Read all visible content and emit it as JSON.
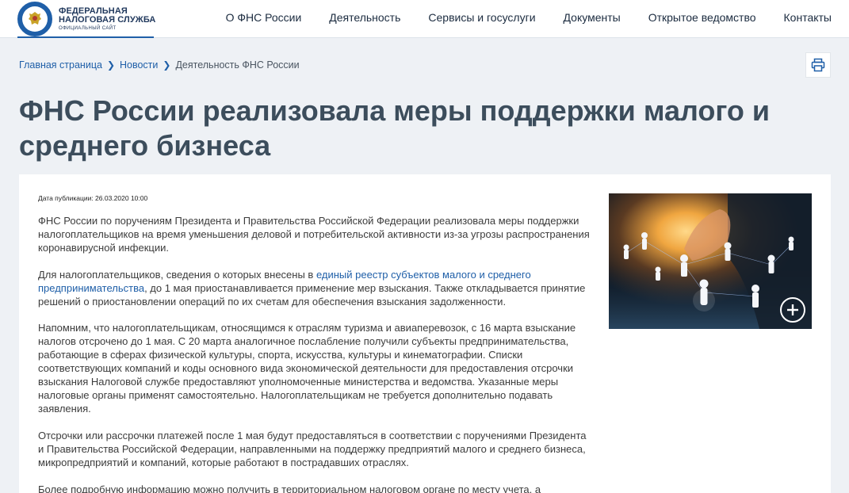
{
  "header": {
    "logo": {
      "line1": "ФЕДЕРАЛЬНАЯ",
      "line2": "НАЛОГОВАЯ СЛУЖБА",
      "sub": "ОФИЦИАЛЬНЫЙ САЙТ"
    },
    "nav": [
      {
        "label": "О ФНС России"
      },
      {
        "label": "Деятельность"
      },
      {
        "label": "Сервисы и госуслуги"
      },
      {
        "label": "Документы"
      },
      {
        "label": "Открытое ведомство"
      },
      {
        "label": "Контакты"
      }
    ]
  },
  "breadcrumb": {
    "items": [
      "Главная страница",
      "Новости"
    ],
    "current": "Деятельность ФНС России"
  },
  "print_icon": "printer-icon",
  "article": {
    "title": "ФНС России реализовала меры поддержки малого и среднего бизнеса",
    "pubdate": "Дата публикации: 26.03.2020 10:00",
    "p1": "ФНС России по поручениям Президента и Правительства Российской Федерации реализовала меры поддержки налогоплательщиков на время уменьшения деловой и потребительской активности из-за угрозы распространения коронавирусной инфекции.",
    "p2_before": "Для налогоплательщиков, сведения о которых внесены в ",
    "p2_link": "единый реестр субъектов малого и среднего предпринимательства",
    "p2_after": ", до 1 мая приостанавливается применение мер взыскания. Также откладывается принятие решений о приостановлении операций по их счетам для обеспечения взыскания задолженности.",
    "p3": "Напомним, что налогоплательщикам, относящимся к отраслям туризма и авиаперевозок, с 16 марта взыскание налогов отсрочено до 1 мая. С 20 марта аналогичное послабление получили субъекты предпринимательства, работающие в сферах физической культуры, спорта, искусства, культуры и кинематографии. Списки соответствующих компаний и коды основного вида экономической деятельности для предоставления отсрочки взыскания Налоговой службе предоставляют уполномоченные министерства и ведомства. Указанные меры налоговые органы применят самостоятельно. Налогоплательщикам не требуется дополнительно подавать заявления.",
    "p4": "Отсрочки или рассрочки платежей после 1 мая будут предоставляться в соответствии с поручениями Президента и Правительства Российской Федерации, направленными на поддержку предприятий малого и среднего бизнеса, микропредприятий и компаний, которые работают в пострадавших отраслях.",
    "p5": "Более подробную информацию можно получить в территориальном налоговом органе по месту учета, а"
  },
  "image_zoom_icon": "zoom-plus-icon",
  "colors": {
    "brand": "#1f5fa8",
    "title": "#3c4d5c",
    "background": "#eef1f5"
  }
}
